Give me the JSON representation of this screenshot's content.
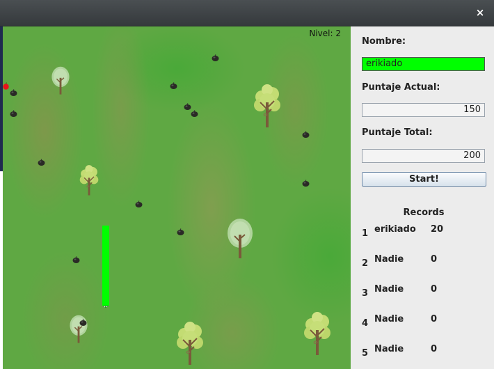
{
  "window": {
    "close_glyph": "×"
  },
  "game": {
    "level_text": "Nivel: 2",
    "snake_color": "#00ff00",
    "icons": [
      "tree-icon",
      "bomb-icon",
      "apple-icon",
      "snake-icon"
    ]
  },
  "panel": {
    "name_label": "Nombre:",
    "name_value": "erikiado",
    "current_score_label": "Puntaje Actual:",
    "current_score_value": "150",
    "total_score_label": "Puntaje Total:",
    "total_score_value": "200",
    "start_label": "Start!",
    "records_title": "Records",
    "records": [
      {
        "rank": "1",
        "name": "erikiado",
        "score": "20"
      },
      {
        "rank": "2",
        "name": "Nadie",
        "score": "0"
      },
      {
        "rank": "3",
        "name": "Nadie",
        "score": "0"
      },
      {
        "rank": "4",
        "name": "Nadie",
        "score": "0"
      },
      {
        "rank": "5",
        "name": "Nadie",
        "score": "0"
      }
    ]
  }
}
